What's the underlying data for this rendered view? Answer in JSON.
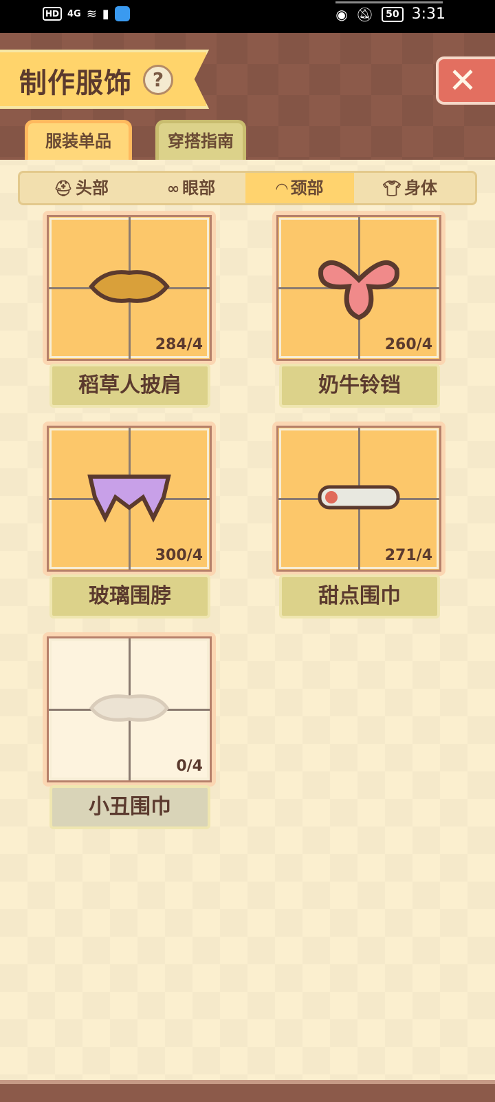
{
  "status_bar": {
    "hd": "HD",
    "signal": "4G",
    "battery": "50",
    "time": "3:31"
  },
  "header": {
    "title": "制作服饰",
    "help": "?",
    "close": "✕"
  },
  "tabs": [
    {
      "label": "服装单品",
      "active": true
    },
    {
      "label": "穿搭指南",
      "active": false
    }
  ],
  "categories": [
    {
      "label": "头部",
      "icon": "hat-icon",
      "active": false
    },
    {
      "label": "眼部",
      "icon": "glasses-icon",
      "active": false
    },
    {
      "label": "颈部",
      "icon": "scarf-icon",
      "active": true
    },
    {
      "label": "身体",
      "icon": "shirt-icon",
      "active": false
    }
  ],
  "items": [
    {
      "name": "稻草人披肩",
      "count": "284/4",
      "locked": false,
      "accent": "#d9a03a"
    },
    {
      "name": "奶牛铃铛",
      "count": "260/4",
      "locked": false,
      "accent": "#f08a8a"
    },
    {
      "name": "玻璃围脖",
      "count": "300/4",
      "locked": false,
      "accent": "#c8a0e8"
    },
    {
      "name": "甜点围巾",
      "count": "271/4",
      "locked": false,
      "accent": "#e8e8e0"
    },
    {
      "name": "小丑围巾",
      "count": "0/4",
      "locked": true,
      "accent": "#ece3d3"
    }
  ]
}
